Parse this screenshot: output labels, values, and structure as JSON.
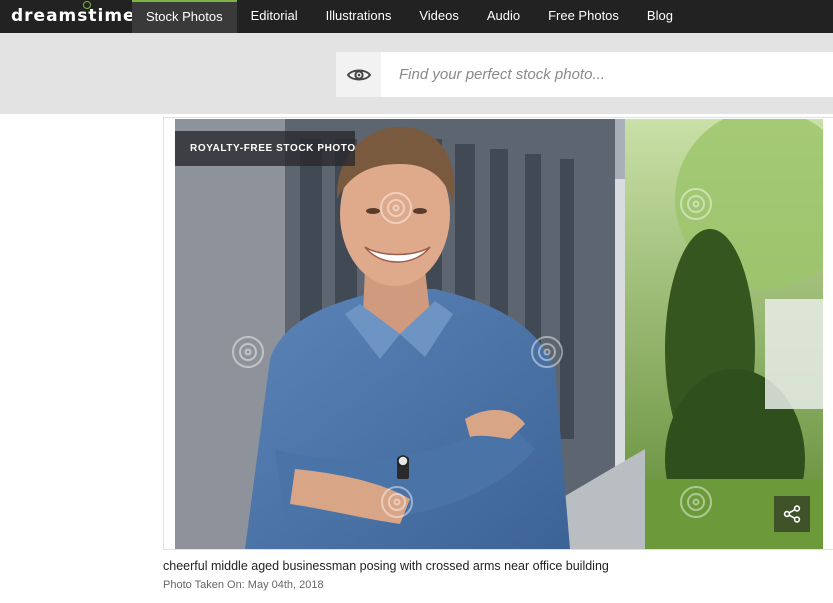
{
  "brand": {
    "logo_text": "dreamstime",
    "accent_color": "#7cb342"
  },
  "nav": {
    "tabs": [
      {
        "label": "Stock Photos",
        "active": true
      },
      {
        "label": "Editorial",
        "active": false
      },
      {
        "label": "Illustrations",
        "active": false
      },
      {
        "label": "Videos",
        "active": false
      },
      {
        "label": "Audio",
        "active": false
      },
      {
        "label": "Free Photos",
        "active": false
      },
      {
        "label": "Blog",
        "active": false
      }
    ]
  },
  "search": {
    "placeholder": "Find your perfect stock photo...",
    "value": "",
    "icon": "eye-icon"
  },
  "photo": {
    "badge": "ROYALTY-FREE STOCK PHOTO",
    "watermark": "dreamstime",
    "share_icon": "share-icon",
    "title": "cheerful middle aged businessman posing with crossed arms near office building",
    "taken_on": "Photo Taken On: May 04th, 2018"
  }
}
